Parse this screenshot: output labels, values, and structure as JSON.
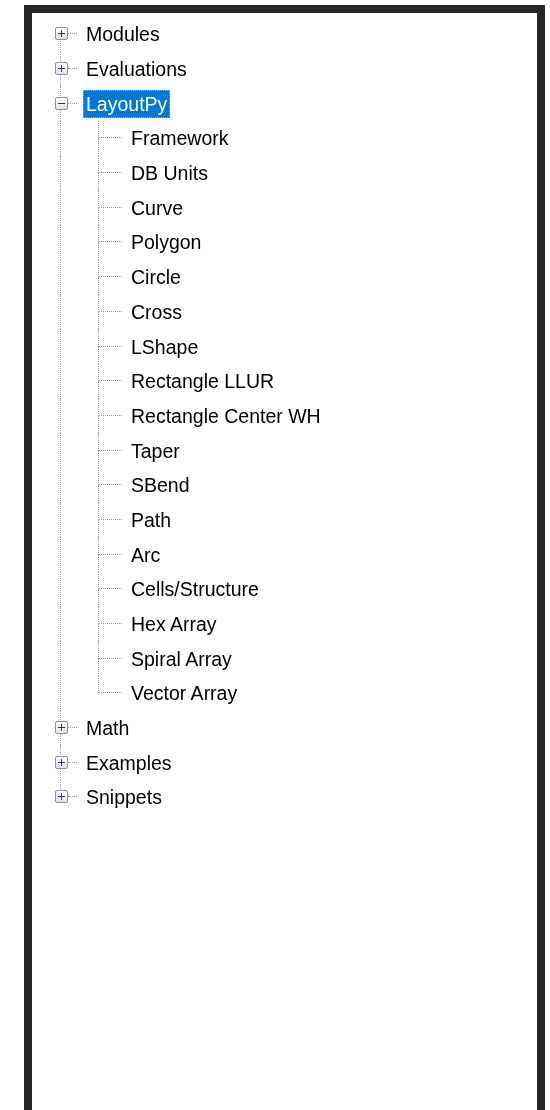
{
  "tree": [
    {
      "label": "Modules",
      "expanded": false,
      "selected": false
    },
    {
      "label": "Evaluations",
      "expanded": false,
      "selected": false
    },
    {
      "label": "LayoutPy",
      "expanded": true,
      "selected": true,
      "children": [
        {
          "label": "Framework",
          "selected": false
        },
        {
          "label": "DB Units",
          "selected": false
        },
        {
          "label": "Curve",
          "selected": false
        },
        {
          "label": "Polygon",
          "selected": false
        },
        {
          "label": "Circle",
          "selected": false
        },
        {
          "label": "Cross",
          "selected": false
        },
        {
          "label": "LShape",
          "selected": false
        },
        {
          "label": "Rectangle LLUR",
          "selected": false
        },
        {
          "label": "Rectangle Center WH",
          "selected": false
        },
        {
          "label": "Taper",
          "selected": false
        },
        {
          "label": "SBend",
          "selected": false
        },
        {
          "label": "Path",
          "selected": false
        },
        {
          "label": "Arc",
          "selected": false
        },
        {
          "label": "Cells/Structure",
          "selected": false
        },
        {
          "label": "Hex Array",
          "selected": false
        },
        {
          "label": "Spiral Array",
          "selected": false
        },
        {
          "label": "Vector Array",
          "selected": false
        }
      ]
    },
    {
      "label": "Math",
      "expanded": false,
      "selected": false
    },
    {
      "label": "Examples",
      "expanded": false,
      "selected": false
    },
    {
      "label": "Snippets",
      "expanded": false,
      "selected": false
    }
  ]
}
